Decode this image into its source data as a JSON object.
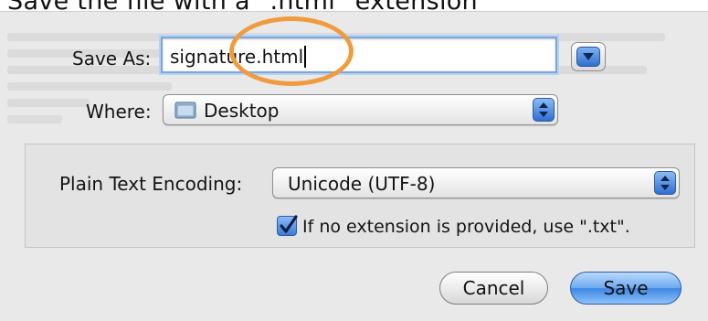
{
  "caption": "Save the file with a \".html\" extension",
  "dialog": {
    "save_as_label": "Save As:",
    "filename_value": "signature.html",
    "where_label": "Where:",
    "where_value": "Desktop",
    "encoding_label": "Plain Text Encoding:",
    "encoding_value": "Unicode (UTF-8)",
    "extension_checkbox_label": "If no extension is provided, use \".txt\".",
    "extension_checkbox_checked": true,
    "cancel_label": "Cancel",
    "save_label": "Save"
  },
  "icons": {
    "expand": "chevron-down-icon",
    "folder": "folder-icon",
    "stepper": "up-down-arrows-icon",
    "checkmark": "checkmark-icon"
  },
  "colors": {
    "accent_blue": "#3d86e3",
    "highlight_orange": "#ef9b3e",
    "dialog_background": "#e9e9e9"
  }
}
